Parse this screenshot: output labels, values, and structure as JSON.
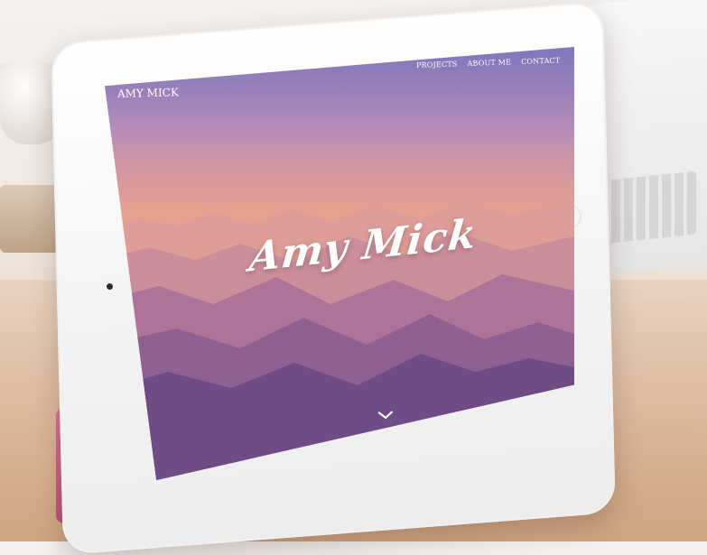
{
  "site": {
    "logo": "AMY MICK",
    "hero_title": "Amy Mick",
    "nav": [
      {
        "label": "PROJECTS"
      },
      {
        "label": "ABOUT ME"
      },
      {
        "label": "CONTACT"
      }
    ]
  },
  "icons": {
    "scroll": "chevron-down-icon",
    "camera": "camera-dot-icon",
    "home_button": "home-button-icon"
  },
  "colors": {
    "sky_top": "#8a7ab8",
    "sky_mid": "#f0a07e",
    "mountain_far": "#c7849f",
    "mountain_near": "#6f4c86",
    "text": "#ffffff"
  }
}
